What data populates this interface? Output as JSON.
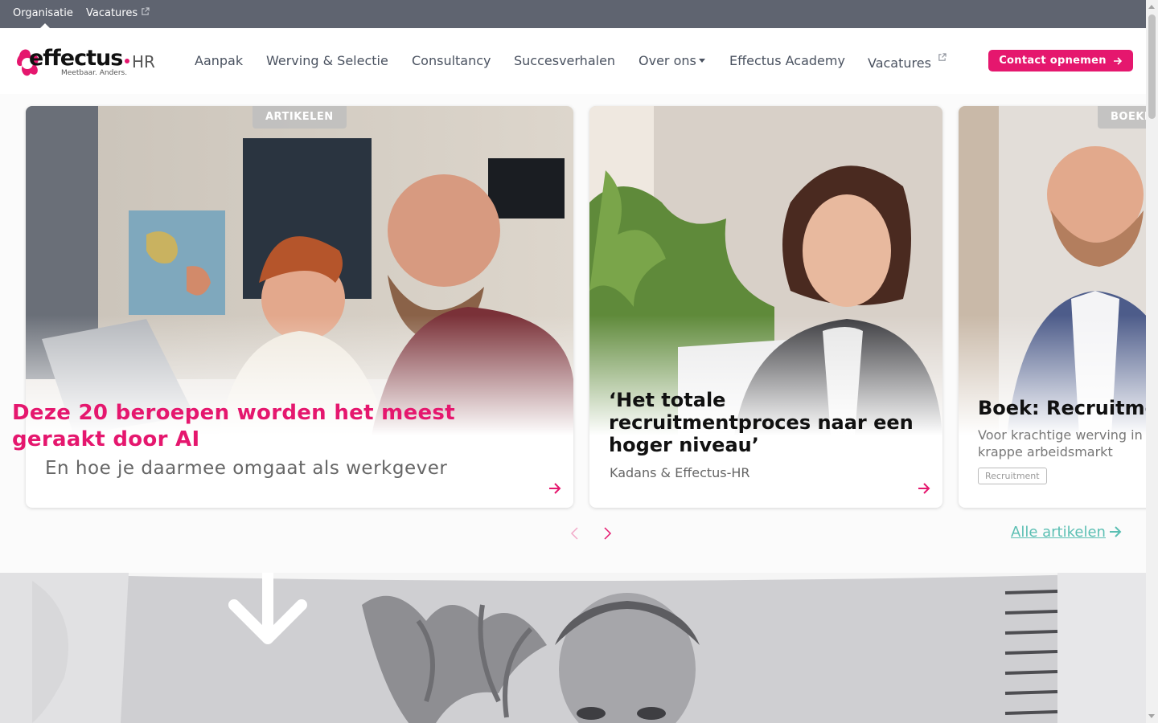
{
  "topbar": {
    "organisatie": "Organisatie",
    "vacatures": "Vacatures"
  },
  "logo": {
    "brand": "effectus",
    "suffix": "HR",
    "tagline": "Meetbaar. Anders."
  },
  "nav": {
    "items": [
      "Aanpak",
      "Werving & Selectie",
      "Consultancy",
      "Succesverhalen",
      "Over ons",
      "Effectus Academy",
      "Vacatures"
    ],
    "contact_label": "Contact opnemen"
  },
  "cards": [
    {
      "badge": "ARTIKELEN",
      "title": "Deze 20 beroepen worden het meest geraakt door AI",
      "subtitle": "En hoe je daarmee omgaat als werkgever"
    },
    {
      "title": "‘Het totale recruitmentproces naar een hoger niveau’",
      "subtitle": "Kadans & Effectus-HR"
    },
    {
      "badge": "BOEKEN",
      "title": "Boek: Recruitment",
      "subtitle": "Voor krachtige werving in een krappe arbeidsmarkt",
      "tag": "Recruitment"
    }
  ],
  "carousel": {
    "all_link": "Alle artikelen"
  },
  "colors": {
    "brand_pink": "#e5176e",
    "teal_link": "#5bbfb3",
    "topbar_bg": "#5f6470"
  }
}
